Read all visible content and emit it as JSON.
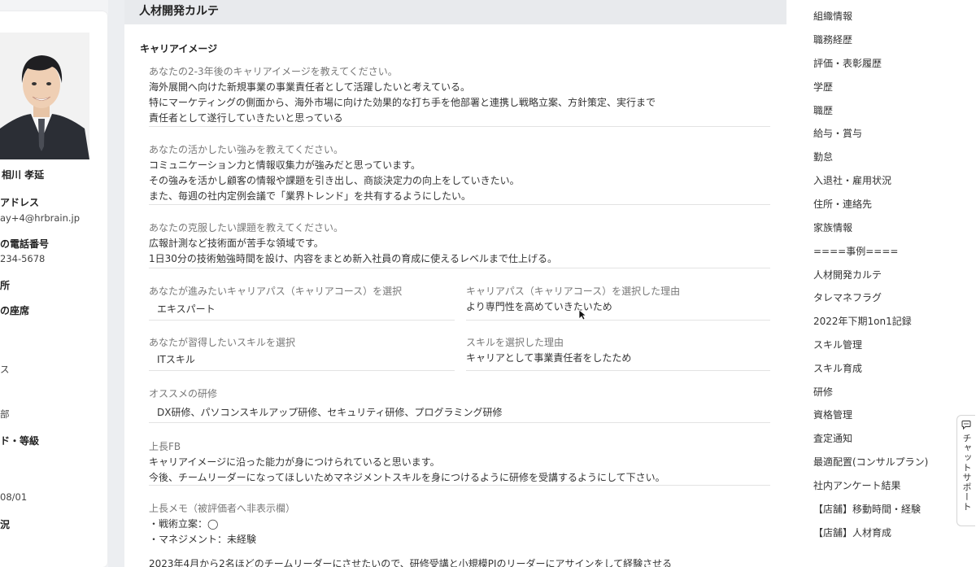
{
  "profile": {
    "name": "相川 孝延",
    "fields": [
      {
        "label": "アドレス",
        "value": "ay+4@hrbrain.jp"
      },
      {
        "label": "の電話番号",
        "value": "234-5678"
      },
      {
        "label": "所",
        "value": ""
      },
      {
        "label": "の座席",
        "value": ""
      }
    ],
    "fragments": [
      "ス",
      "部",
      "ド・等級",
      "08/01",
      "況"
    ]
  },
  "main": {
    "header_title": "人材開発カルテ",
    "section_title": "キャリアイメージ",
    "questions": [
      {
        "question": "あなたの2-3年後のキャリアイメージを教えてください。",
        "answer_lines": [
          "海外展開へ向けた新規事業の事業責任者として活躍したいと考えている。",
          "特にマーケティングの側面から、海外市場に向けた効果的な打ち手を他部署と連携し戦略立案、方針策定、実行まで",
          "責任者として遂行していきたいと思っている"
        ]
      },
      {
        "question": "あなたの活かしたい強みを教えてください。",
        "answer_lines": [
          "コミュニケーション力と情報収集力が強みだと思っています。",
          "その強みを活かし顧客の情報や課題を引き出し、商談決定力の向上をしていきたい。",
          "また、毎週の社内定例会議で「業界トレンド」を共有するようにしたい。"
        ]
      },
      {
        "question": "あなたの克服したい課題を教えてください。",
        "answer_lines": [
          "広報計測など技術面が苦手な領域です。",
          "1日30分の技術勉強時間を設け、内容をまとめ新入社員の育成に使えるレベルまで仕上げる。"
        ]
      }
    ],
    "career_path": {
      "label": "あなたが進みたいキャリアパス（キャリアコース）を選択",
      "value": "エキスパート",
      "reason_label": "キャリアパス（キャリアコース）を選択した理由",
      "reason_value": "より専門性を高めていきたいため"
    },
    "skill": {
      "label": "あなたが習得したいスキルを選択",
      "value": "ITスキル",
      "reason_label": "スキルを選択した理由",
      "reason_value": "キャリアとして事業責任者をしたため"
    },
    "training": {
      "label": "オススメの研修",
      "value": "DX研修、パソコンスキルアップ研修、セキュリティ研修、プログラミング研修"
    },
    "boss_fb": {
      "label": "上長FB",
      "lines": [
        "キャリアイメージに沿った能力が身につけられていると思います。",
        "今後、チームリーダーになってほしいためマネジメントスキルを身につけるように研修を受講するようにして下さい。"
      ]
    },
    "boss_memo": {
      "label": "上長メモ（被評価者へ非表示欄）",
      "lines": [
        "・戦術立案：◯",
        "・マネジメント：未経験"
      ],
      "cut_line": "2023年4月から2名ほどのチームリーダーにさせたいので、研修受講と小規模PJのリーダーにアサインをして経験させる"
    }
  },
  "menu": {
    "items": [
      "組織情報",
      "職務経歴",
      "評価・表彰履歴",
      "学歴",
      "職歴",
      "給与・賞与",
      "勤怠",
      "入退社・雇用状況",
      "住所・連絡先",
      "家族情報",
      "====事例====",
      "人材開発カルテ",
      "タレマネフラグ",
      "2022年下期1on1記録",
      "スキル管理",
      "スキル育成",
      "研修",
      "資格管理",
      "査定通知",
      "最適配置(コンサルプラン)",
      "社内アンケート結果",
      "【店舗】移動時間・経験",
      "【店舗】人材育成"
    ]
  },
  "chat": {
    "label": "チャットサポート",
    "icon": "chat-bubble-icon"
  }
}
